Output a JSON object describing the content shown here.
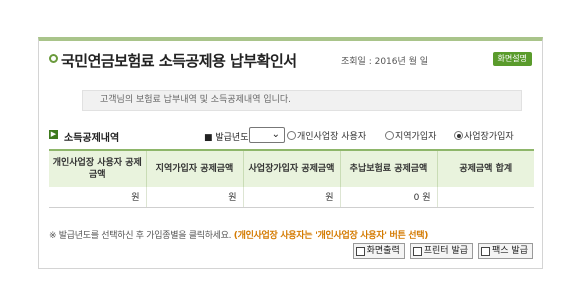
{
  "header": {
    "title": "국민연금보험료 소득공제용 납부확인서",
    "inquiry_date": "조회일 : 2016년   월   일",
    "screen_help_label": "화면설명"
  },
  "description": "고객님의 보험료 납부내역 및 소득공제내역 입니다.",
  "filter": {
    "section_label": "소득공제내역",
    "issue_year_label": "■ 발급년도",
    "issue_year_value": "",
    "options": [
      {
        "label": "개인사업장 사용자",
        "selected": false
      },
      {
        "label": "지역가입자",
        "selected": false
      },
      {
        "label": "사업장가입자",
        "selected": true
      }
    ]
  },
  "table": {
    "headers": [
      "개인사업장 사용자 공제금액",
      "지역가입자 공제금액",
      "사업장가입자 공제금액",
      "추납보험료 공제금액",
      "공제금액 합계"
    ],
    "row": [
      "원",
      "원",
      "원",
      "0 원",
      ""
    ]
  },
  "note": {
    "text": "※ 발급년도를 선택하신 후 가입종별을 클릭하세요.",
    "highlight": "(개인사업장 사용자는 '개인사업장 사용자' 버튼 선택)"
  },
  "buttons": {
    "screen_print": "화면출력",
    "printer_issue": "프린터 발급",
    "fax_issue": "팩스 발급"
  },
  "colors": {
    "accent_green": "#5a9b2c",
    "header_bg": "#e9f3dd",
    "highlight_orange": "#d47a00"
  }
}
